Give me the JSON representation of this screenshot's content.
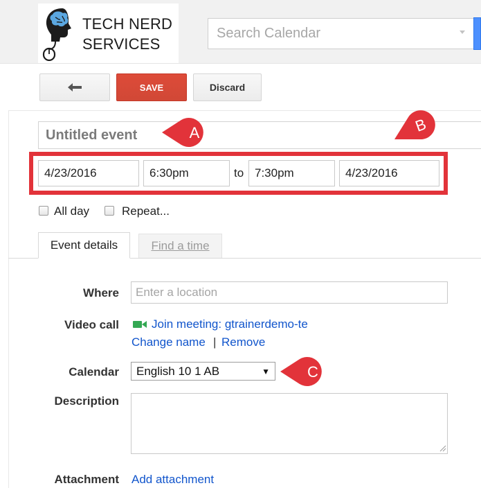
{
  "logo": {
    "line1": "TECH NERD",
    "line2": "SERVICES"
  },
  "search": {
    "placeholder": "Search Calendar"
  },
  "toolbar": {
    "back_icon": "back-arrow-icon",
    "save_label": "SAVE",
    "discard_label": "Discard"
  },
  "event": {
    "title": "Untitled event",
    "start_date": "4/23/2016",
    "start_time": "6:30pm",
    "to_label": "to",
    "end_time": "7:30pm",
    "end_date": "4/23/2016"
  },
  "options": {
    "all_day": "All day",
    "repeat": "Repeat..."
  },
  "tabs": [
    {
      "label": "Event details"
    },
    {
      "label": "Find a time"
    }
  ],
  "form": {
    "where_label": "Where",
    "where_placeholder": "Enter a location",
    "video_label": "Video call",
    "join_text": "Join meeting: gtrainerdemo-te",
    "change_name": "Change name",
    "separator": "|",
    "remove": "Remove",
    "calendar_label": "Calendar",
    "calendar_value": "English 10 1 AB",
    "description_label": "Description",
    "attachment_label": "Attachment",
    "add_attachment": "Add attachment"
  },
  "callouts": {
    "a": "A",
    "b": "B",
    "c": "C"
  },
  "colors": {
    "accent_red": "#e2333a",
    "save_red": "#d14836",
    "link_blue": "#1155cc",
    "video_green": "#34a853"
  }
}
